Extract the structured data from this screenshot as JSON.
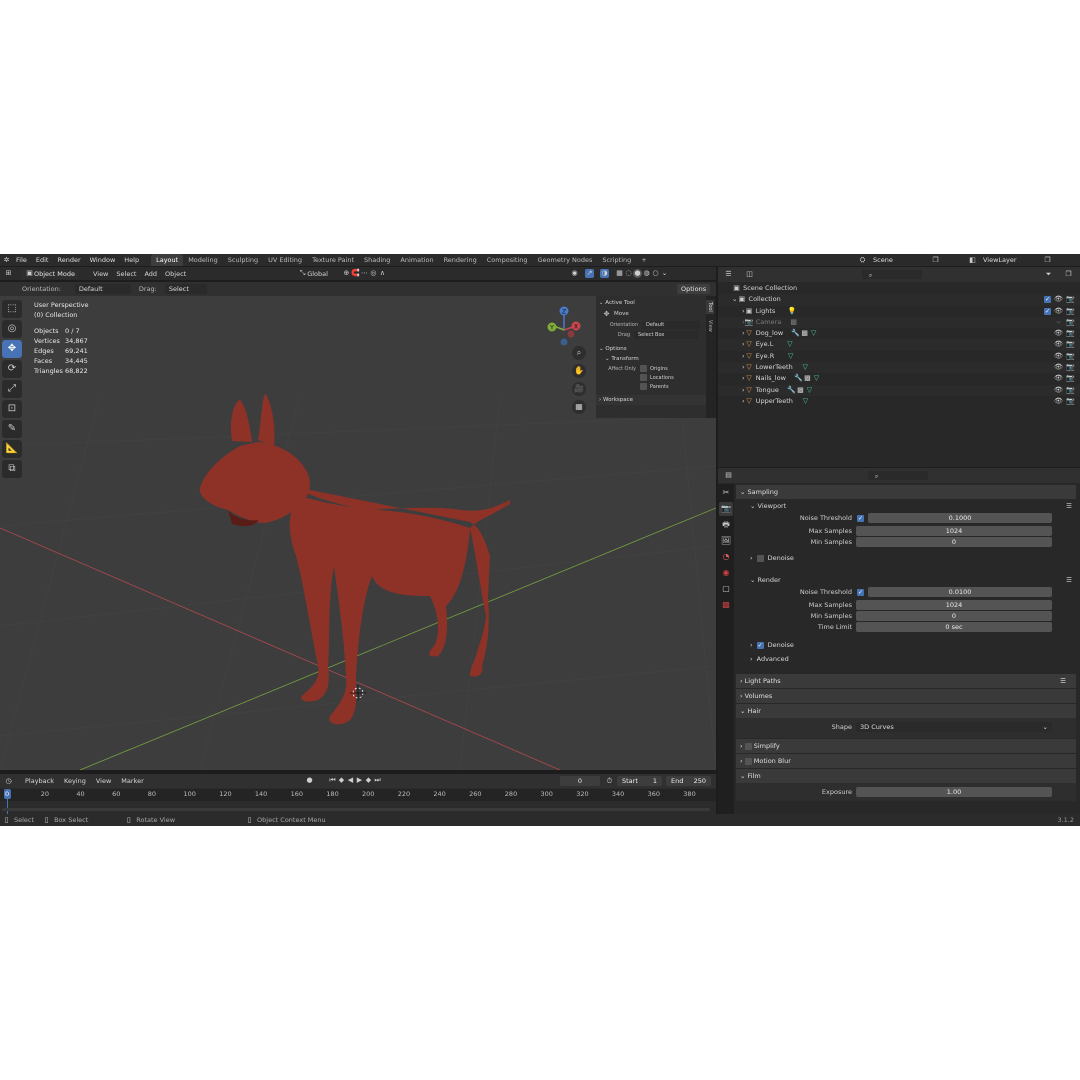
{
  "topbar": {
    "menus": [
      "File",
      "Edit",
      "Render",
      "Window",
      "Help"
    ],
    "workspaces": [
      "Layout",
      "Modeling",
      "Sculpting",
      "UV Editing",
      "Texture Paint",
      "Shading",
      "Animation",
      "Rendering",
      "Compositing",
      "Geometry Nodes",
      "Scripting"
    ],
    "add": "+",
    "scene": "Scene",
    "viewlayer": "ViewLayer"
  },
  "vphead": {
    "mode": "Object Mode",
    "menus": [
      "View",
      "Select",
      "Add",
      "Object"
    ],
    "transform": "Global"
  },
  "vphead2": {
    "orientation_label": "Orientation:",
    "orientation": "Default",
    "drag_label": "Drag:",
    "drag": "Select Box",
    "options": "Options"
  },
  "stats": {
    "perspective": "User Perspective",
    "collection": "(0) Collection",
    "rows": [
      {
        "k": "Objects",
        "v": "0 / 7"
      },
      {
        "k": "Vertices",
        "v": "34,867"
      },
      {
        "k": "Edges",
        "v": "69,241"
      },
      {
        "k": "Faces",
        "v": "34,445"
      },
      {
        "k": "Triangles",
        "v": "68,822"
      }
    ]
  },
  "npanel": {
    "active_tool": "Active Tool",
    "move": "Move",
    "orientation_label": "Orientation",
    "orientation": "Default",
    "drag_label": "Drag",
    "drag": "Select Box",
    "options": "Options",
    "transform": "Transform",
    "affect_only": "Affect Only",
    "origins": "Origins",
    "locations": "Locations",
    "parents": "Parents",
    "workspace": "Workspace",
    "tabs": [
      "Tool",
      "View"
    ]
  },
  "gizmo": {
    "x": "X",
    "y": "Y",
    "z": "Z"
  },
  "timeline": {
    "menus": [
      "Playback",
      "Keying",
      "View",
      "Marker"
    ],
    "frame": "0",
    "start_label": "Start",
    "start": "1",
    "end_label": "End",
    "end": "250",
    "ticks": [
      "0",
      "20",
      "40",
      "60",
      "80",
      "100",
      "120",
      "140",
      "160",
      "180",
      "200",
      "220",
      "240",
      "260",
      "280",
      "300",
      "320",
      "340",
      "360",
      "380"
    ]
  },
  "statusbar": {
    "select": "Select",
    "box_select": "Box Select",
    "rotate": "Rotate View",
    "context": "Object Context Menu",
    "version": "3.1.2"
  },
  "outliner": {
    "scene_collection": "Scene Collection",
    "collection": "Collection",
    "items": [
      "Lights",
      "Camera",
      "Dog_low",
      "Eye.L",
      "Eye.R",
      "LowerTeeth",
      "Nails_low",
      "Tongue",
      "UpperTeeth"
    ]
  },
  "props": {
    "sampling": "Sampling",
    "viewport": "Viewport",
    "noise_threshold": "Noise Threshold",
    "vp_noise": "0.1000",
    "max_samples": "Max Samples",
    "vp_max": "1024",
    "min_samples": "Min Samples",
    "vp_min": "0",
    "denoise": "Denoise",
    "render": "Render",
    "r_noise": "0.0100",
    "r_max": "1024",
    "r_min": "0",
    "time_limit": "Time Limit",
    "r_time": "0 sec",
    "advanced": "Advanced",
    "light_paths": "Light Paths",
    "volumes": "Volumes",
    "hair": "Hair",
    "shape_label": "Shape",
    "shape": "3D Curves",
    "simplify": "Simplify",
    "motion_blur": "Motion Blur",
    "film": "Film",
    "exposure_label": "Exposure",
    "exposure": "1.00"
  },
  "colors": {
    "accent": "#4772b3",
    "dog": "#8e3228",
    "x_axis": "#c8474d",
    "y_axis": "#7fae3c"
  }
}
